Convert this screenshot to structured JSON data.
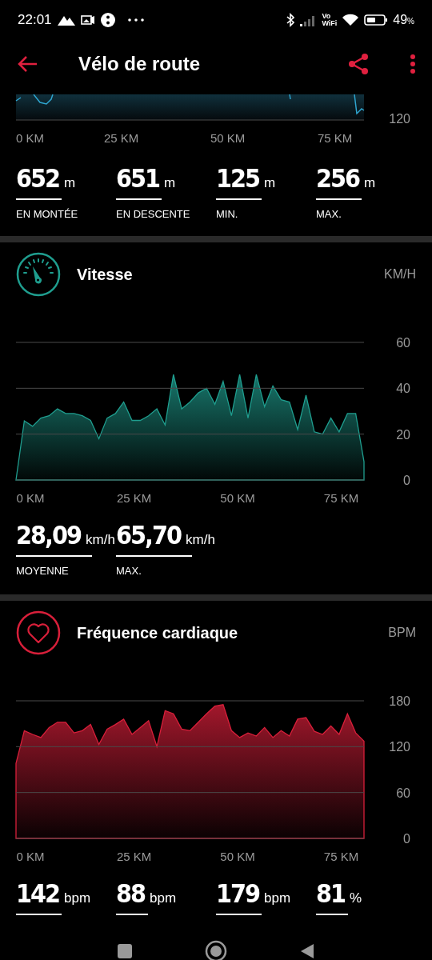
{
  "status_bar": {
    "time": "22:01",
    "vowifi": [
      "Vo",
      "WiFi"
    ],
    "battery": "49",
    "battery_unit": "%"
  },
  "app_bar": {
    "title": "Vélo de route"
  },
  "elevation": {
    "y_tick": "120",
    "x_labels": [
      "0 KM",
      "25 KM",
      "50 KM",
      "75 KM"
    ],
    "stats": [
      {
        "value": "652",
        "unit": "m",
        "label": "EN MONTÉE"
      },
      {
        "value": "651",
        "unit": "m",
        "label": "EN DESCENTE"
      },
      {
        "value": "125",
        "unit": "m",
        "label": "MIN."
      },
      {
        "value": "256",
        "unit": "m",
        "label": "MAX."
      }
    ]
  },
  "sections": [
    {
      "kind": "speed",
      "unit": "KM/H",
      "chart_data": {
        "type": "area",
        "x": [
          -3.5,
          -1.5,
          0.5,
          2.5,
          4.5,
          6.5,
          8.5,
          10.5,
          12.5,
          14.5,
          16.5,
          18.5,
          20.5,
          22.5,
          24.5,
          26.5,
          28.5,
          30.5,
          32.5,
          34.5,
          36.5,
          38.5,
          40.5,
          42.5,
          44.5,
          46.5,
          48.5,
          50.5,
          52.5,
          54.5,
          56.5,
          58.5,
          60.5,
          62.5,
          64.5,
          66.5,
          68.5,
          70.5,
          72.5,
          74.5,
          76.5,
          78.5,
          80.5
        ],
        "series": [
          {
            "name": "Vitesse",
            "color": "#1f9e8f",
            "values": [
              0,
              25.8,
              23.4,
              27,
              28,
              31,
              29,
              29,
              28,
              26,
              18,
              27,
              29,
              34,
              26,
              26,
              28,
              31,
              24,
              46,
              31,
              34,
              38,
              40,
              33,
              43,
              28,
              46,
              27,
              46,
              32,
              41,
              35,
              34,
              22,
              37,
              21,
              20,
              27,
              21,
              29,
              29,
              8
            ]
          }
        ],
        "xlim": [
          -3.5,
          80.5
        ],
        "ylim": [
          0,
          60
        ],
        "xticks": [
          {
            "value": 0,
            "label": "0 KM"
          },
          {
            "value": 25,
            "label": "25 KM"
          },
          {
            "value": 50,
            "label": "50 KM"
          },
          {
            "value": 75,
            "label": "75 KM"
          }
        ],
        "yticks": [
          0,
          20,
          40,
          60
        ]
      },
      "stats": [
        {
          "value": "28,09",
          "unit": "km/h",
          "label": "MOYENNE"
        },
        {
          "value": "65,70",
          "unit": "km/h",
          "label": "MAX."
        }
      ]
    },
    {
      "kind": "heart",
      "unit": "BPM",
      "chart_data": {
        "type": "area",
        "x": [
          -3.5,
          -1.5,
          0.5,
          2.5,
          4.5,
          6.5,
          8.5,
          10.5,
          12.5,
          14.5,
          16.5,
          18.5,
          20.5,
          22.5,
          24.5,
          26.5,
          28.5,
          30.5,
          32.5,
          34.5,
          36.5,
          38.5,
          40.5,
          42.5,
          44.5,
          46.5,
          48.5,
          50.5,
          52.5,
          54.5,
          56.5,
          58.5,
          60.5,
          62.5,
          64.5,
          66.5,
          68.5,
          70.5,
          72.5,
          74.5,
          76.5,
          78.5,
          80.5
        ],
        "series": [
          {
            "name": "Fréquence cardiaque",
            "color": "#d81f3a",
            "values": [
              98,
              141,
              136,
              132,
              145,
              152,
              152,
              138,
              141,
              149,
              123,
              143,
              149,
              156,
              136,
              145,
              154,
              120,
              167,
              163,
              143,
              141,
              152,
              163,
              173,
              175,
              141,
              132,
              138,
              134,
              145,
              132,
              141,
              134,
              156,
              158,
              140,
              136,
              147,
              136,
              163,
              138,
              127
            ]
          }
        ],
        "xlim": [
          -3.5,
          80.5
        ],
        "ylim": [
          0,
          180
        ],
        "xticks": [
          {
            "value": 0,
            "label": "0 KM"
          },
          {
            "value": 25,
            "label": "25 KM"
          },
          {
            "value": 50,
            "label": "50 KM"
          },
          {
            "value": 75,
            "label": "75 KM"
          }
        ],
        "yticks": [
          0,
          60,
          120,
          180
        ]
      },
      "stats": [
        {
          "value": "142",
          "unit": "bpm"
        },
        {
          "value": "88",
          "unit": "bpm"
        },
        {
          "value": "179",
          "unit": "bpm"
        },
        {
          "value": "81",
          "unit": "%"
        }
      ]
    }
  ]
}
